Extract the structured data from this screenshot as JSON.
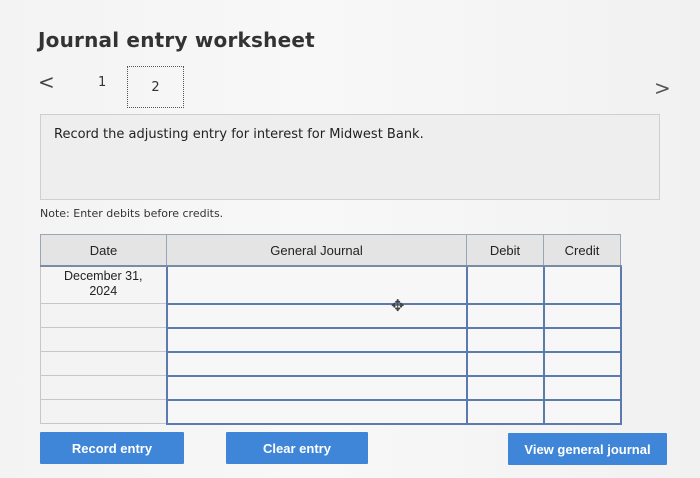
{
  "title": "Journal entry worksheet",
  "pagination": {
    "prev_icon": "<",
    "next_icon": ">",
    "pages": [
      "1",
      "2"
    ],
    "current": "2"
  },
  "prompt": "Record the adjusting entry for interest for Midwest Bank.",
  "note": "Note: Enter debits before credits.",
  "table": {
    "headers": {
      "date": "Date",
      "general_journal": "General Journal",
      "debit": "Debit",
      "credit": "Credit"
    },
    "rows": [
      {
        "date_line1": "December 31,",
        "date_line2": "2024",
        "account": "",
        "debit": "",
        "credit": ""
      },
      {
        "date_line1": "",
        "date_line2": "",
        "account": "",
        "debit": "",
        "credit": ""
      },
      {
        "date_line1": "",
        "date_line2": "",
        "account": "",
        "debit": "",
        "credit": ""
      },
      {
        "date_line1": "",
        "date_line2": "",
        "account": "",
        "debit": "",
        "credit": ""
      },
      {
        "date_line1": "",
        "date_line2": "",
        "account": "",
        "debit": "",
        "credit": ""
      },
      {
        "date_line1": "",
        "date_line2": "",
        "account": "",
        "debit": "",
        "credit": ""
      }
    ]
  },
  "buttons": {
    "record": "Record entry",
    "clear": "Clear entry",
    "view": "View general journal"
  },
  "colors": {
    "button": "#3f86d8",
    "input_border": "#5b7bb0"
  },
  "cursor_icon": "move-cursor-icon"
}
